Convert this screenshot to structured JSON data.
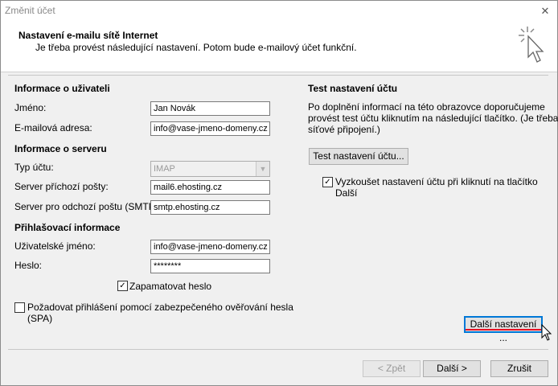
{
  "window": {
    "title": "Změnit účet"
  },
  "header": {
    "title": "Nastavení e-mailu sítě Internet",
    "subtitle": "Je třeba provést následující nastavení. Potom bude e-mailový účet funkční."
  },
  "user_info": {
    "section": "Informace o uživateli",
    "name_label": "Jméno:",
    "name_value": "Jan Novák",
    "email_label": "E-mailová adresa:",
    "email_value": "info@vase-jmeno-domeny.cz"
  },
  "server_info": {
    "section": "Informace o serveru",
    "type_label": "Typ účtu:",
    "type_value": "IMAP",
    "incoming_label": "Server příchozí pošty:",
    "incoming_value": "mail6.ehosting.cz",
    "outgoing_label": "Server pro odchozí poštu (SMTP):",
    "outgoing_value": "smtp.ehosting.cz"
  },
  "login_info": {
    "section": "Přihlašovací informace",
    "username_label": "Uživatelské jméno:",
    "username_value": "info@vase-jmeno-domeny.cz",
    "password_label": "Heslo:",
    "password_value": "********",
    "remember_label": "Zapamatovat heslo",
    "remember_checked": true,
    "spa_label_1": "Požadovat přihlášení pomocí zabezpečeného ověřování hesla",
    "spa_label_2": "(SPA)",
    "spa_checked": false
  },
  "test": {
    "section": "Test nastavení účtu",
    "desc_1": "Po doplnění informací na této obrazovce doporučujeme",
    "desc_2": "provést test účtu kliknutím na následující tlačítko. (Je třeba",
    "desc_3": "síťové připojení.)",
    "button_label": "Test nastavení účtu...",
    "auto_test_label_1": "Vyzkoušet nastavení účtu při kliknutí na tlačítko",
    "auto_test_label_2": "Další",
    "auto_test_checked": true
  },
  "more_settings_button": "Další nastavení ...",
  "footer": {
    "back": "< Zpět",
    "next": "Další >",
    "cancel": "Zrušit"
  },
  "colors": {
    "focus": "#0078d7",
    "underline_accent": "#e81123"
  }
}
